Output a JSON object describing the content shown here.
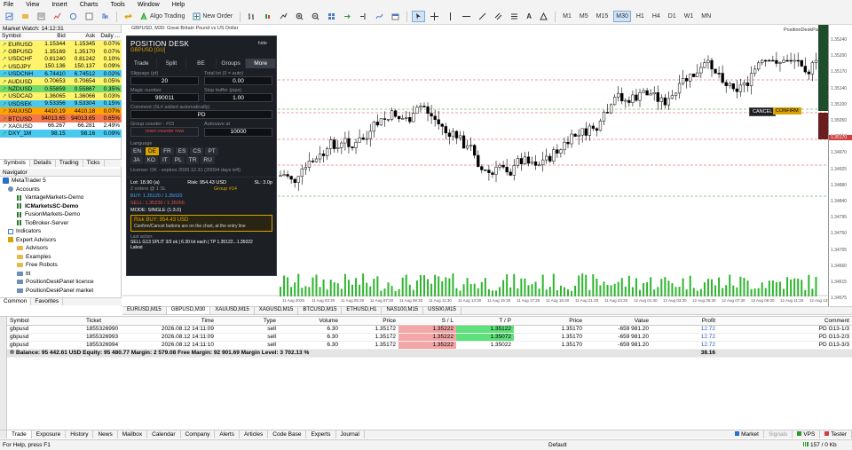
{
  "menu": [
    "File",
    "View",
    "Insert",
    "Charts",
    "Tools",
    "Window",
    "Help"
  ],
  "toolbar": {
    "algo_trading": "Algo Trading",
    "new_order": "New Order",
    "timeframes": [
      "M1",
      "M5",
      "M15",
      "M30",
      "H1",
      "H4",
      "D1",
      "W1",
      "MN"
    ],
    "active_tf": "M30"
  },
  "market_watch": {
    "title": "Market Watch: 14:12:31",
    "headers": [
      "Symbol",
      "Bid",
      "Ask",
      "Daily ..."
    ],
    "rows": [
      {
        "s": "EURUSD",
        "bid": "1.15344",
        "ask": "1.15345",
        "ch": "0.07%",
        "bg": "#fff36b"
      },
      {
        "s": "GBPUSD",
        "bid": "1.35169",
        "ask": "1.35170",
        "ch": "0.07%",
        "bg": "#fff36b"
      },
      {
        "s": "USDCHF",
        "bid": "0.81240",
        "ask": "0.81242",
        "ch": "0.10%",
        "bg": "#fff36b"
      },
      {
        "s": "USDJPY",
        "bid": "150.136",
        "ask": "150.137",
        "ch": "0.09%",
        "bg": "#fff36b"
      },
      {
        "s": "USDCNH",
        "bid": "6.74410",
        "ask": "6.74512",
        "ch": "0.02%",
        "bg": "#49c9f0"
      },
      {
        "s": "AUDUSD",
        "bid": "0.70653",
        "ask": "0.70654",
        "ch": "0.05%",
        "bg": "#fff36b"
      },
      {
        "s": "NZDUSD",
        "bid": "0.55859",
        "ask": "0.55867",
        "ch": "0.35%",
        "bg": "#74d96b"
      },
      {
        "s": "USDCAD",
        "bid": "1.36065",
        "ask": "1.36066",
        "ch": "0.03%",
        "bg": "#fff36b"
      },
      {
        "s": "USDSEK",
        "bid": "9.53356",
        "ask": "9.53304",
        "ch": "0.15%",
        "bg": "#49c9f0"
      },
      {
        "s": "XAUUSD",
        "bid": "4410.19",
        "ask": "4410.18",
        "ch": "0.07%",
        "bg": "#ffa400"
      },
      {
        "s": "BTCUSD",
        "bid": "94013.65",
        "ask": "94013.65",
        "ch": "0.65%",
        "bg": "#f2774d"
      },
      {
        "s": "XAGUSD",
        "bid": "66.267",
        "ask": "66.281",
        "ch": "2.49%",
        "bg": "#ffffff"
      },
      {
        "s": "DXY_1M",
        "bid": "98.15",
        "ask": "98.16",
        "ch": "0.09%",
        "bg": "#49c9f0"
      }
    ],
    "tabs": [
      "Symbols",
      "Details",
      "Trading",
      "Ticks"
    ]
  },
  "navigator": {
    "title": "Navigator",
    "root": "MetaTrader 5",
    "accounts": "Accounts",
    "account_items": [
      "VantageMarkets-Demo",
      "ICMarketsSC-Demo",
      "FusionMarkets-Demo",
      "TioBroker-Server"
    ],
    "indicators": "Indicators",
    "experts": "Expert Advisors",
    "expert_items": [
      "Advisors",
      "Examples",
      "Free Robots",
      "ttt",
      "PositionDeskPanel licence",
      "PositionDeskPanel market"
    ],
    "tabs": [
      "Common",
      "Favorites"
    ]
  },
  "chart": {
    "title": "GBPUSD, M30: Great Britain Pound vs US Dollar",
    "right_label": "PositionDeskPanel",
    "prices": [
      "1.35240",
      "1.35200",
      "1.35170",
      "1.35140",
      "1.35100",
      "1.35050",
      "1.35010",
      "1.34970",
      "1.34925",
      "1.34880",
      "1.34840",
      "1.34795",
      "1.34750",
      "1.34705",
      "1.34660",
      "1.34615",
      "1.34575"
    ],
    "dates": [
      "11 Aug 2026",
      "11 Aug 03:30",
      "11 Aug 05:30",
      "11 Aug 07:30",
      "11 Aug 09:30",
      "11 Aug 11:30",
      "11 Aug 13:30",
      "11 Aug 15:30",
      "11 Aug 17:30",
      "11 Aug 19:30",
      "11 Aug 21:30",
      "11 Aug 23:30",
      "12 Aug 01:30",
      "12 Aug 03:30",
      "12 Aug 05:30",
      "12 Aug 07:30",
      "12 Aug 09:30",
      "12 Aug 11:30",
      "12 Aug 13:30"
    ],
    "cancel": "CANCEL",
    "confirm": "CONFIRM",
    "price_tag": "1.35170"
  },
  "chart_tabs": [
    "EURUSD,M15",
    "GBPUSD,M30",
    "XAUUSD,M15",
    "XAGUSD,M15",
    "BTCUSD,M15",
    "ETHUSD,H1",
    "NAS100,M15",
    "US500,M15"
  ],
  "desk": {
    "title": "POSITION DESK",
    "symbol": "GBPUSD",
    "tf": "[GU]",
    "hide": "hide",
    "tabs": [
      "Trade",
      "Split",
      "BE",
      "Groups",
      "More"
    ],
    "slippage_label": "Slippage (pt)",
    "slippage": "20",
    "total_lot_label": "Total lot (0 = auto)",
    "total_lot": "0.00",
    "magic_label": "Magic number",
    "magic": "990011",
    "stop_buffer_label": "Stop buffer (pips)",
    "stop_buffer": "1.00",
    "comment_label": "Comment (SL# added automatically)",
    "comment": "PD",
    "group_label": "Group counter - #15",
    "reset_label": "reset counter now",
    "autosave_label": "Autosave at",
    "autosave": "10000",
    "language_label": "Language",
    "langs": [
      "EN",
      "DE",
      "FR",
      "ES",
      "CS",
      "PT",
      "JA",
      "KO",
      "IT",
      "PL",
      "TR",
      "RU"
    ],
    "active_lang": "DE",
    "license": "License: OK - expires 2099.12.31 (20094 days left)",
    "lot": "Lot: 18.90 (a)",
    "risk": "Risk: 954.43 USD",
    "sl_count": "SL: 3.0p",
    "entry": "2 orders @ 1 SL",
    "group": "Group #14",
    "buy": "BUY: 1.35120 / 1.35020",
    "sell": "SELL: 1.35236 / 1.35056",
    "mode": "MODE: SINGLE (1:3.0)",
    "risk_box_title": "Risk BUY: 954.43 USD",
    "risk_box_text": "Confirm/Cancel buttons are on the chart, at the entry line",
    "last": "Last action:",
    "last_text": "SELL G13 SPLIT 3/3 ok | 6.30 lot each | TP 1.35122...1.35022",
    "last2": "Latest"
  },
  "trade": {
    "headers": [
      "Symbol",
      "Ticket",
      "Time",
      "Type",
      "Volume",
      "Price",
      "S / L",
      "T / P",
      "Price",
      "Value",
      "Profit",
      "Comment"
    ],
    "rows": [
      {
        "sym": "gbpusd",
        "ticket": "1855326990",
        "time": "2026.08.12 14:11:09",
        "type": "sell",
        "vol": "6.30",
        "price": "1.35172",
        "sl": "1.35222",
        "tp": "1.35122",
        "cur": "1.35170",
        "val": "-659 981.20",
        "profit": "12.72",
        "comment": "PD G13-1/3"
      },
      {
        "sym": "gbpusd",
        "ticket": "1855326993",
        "time": "2026.08.12 14:11:09",
        "type": "sell",
        "vol": "6.30",
        "price": "1.35172",
        "sl": "1.35222",
        "tp": "1.35072",
        "cur": "1.35170",
        "val": "-659 981.20",
        "profit": "12.72",
        "comment": "PD G13-2/3"
      },
      {
        "sym": "gbpusd",
        "ticket": "1855326994",
        "time": "2026.08.12 14:11:10",
        "type": "sell",
        "vol": "6.30",
        "price": "1.35172",
        "sl": "1.35222",
        "tp": "1.35022",
        "cur": "1.35170",
        "val": "-659 981.20",
        "profit": "12.72",
        "comment": "PD G13-3/3"
      }
    ],
    "balance": "Balance: 95 442.61 USD  Equity: 95 480.77  Margin: 2 579.08  Free Margin: 92 901.69  Margin Level: 3 702.13 %",
    "total": "38.16"
  },
  "bottom_tabs": [
    "Trade",
    "Exposure",
    "History",
    "News",
    "Mailbox",
    "Calendar",
    "Company",
    "Alerts",
    "Articles",
    "Code Base",
    "Experts",
    "Journal"
  ],
  "bottom_right": [
    "Market",
    "Signals",
    "VPS",
    "Tester"
  ],
  "status": {
    "help": "For Help, press F1",
    "profile": "Default",
    "conn": "157 / 0 Kb"
  },
  "colors": {
    "sl_bg": "#f4a6a6",
    "tp_bg": "#5ee07a",
    "bull": "#ffffff",
    "bear": "#000000",
    "volume": "#2db52d"
  }
}
